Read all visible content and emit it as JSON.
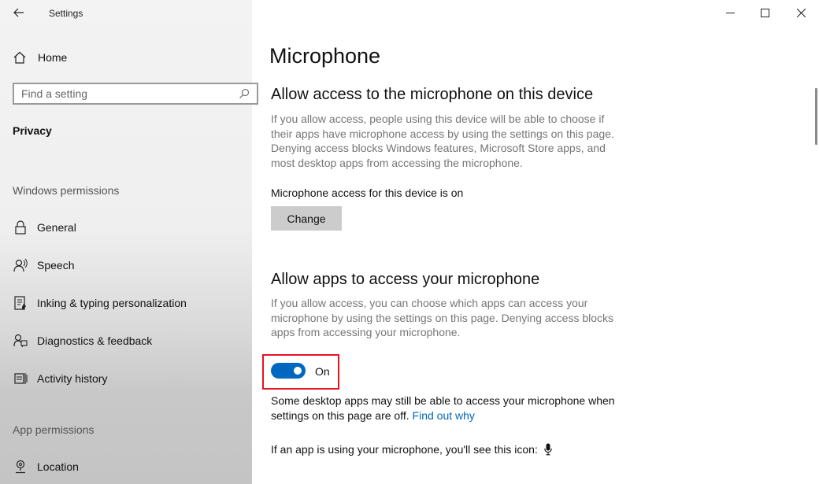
{
  "window": {
    "title": "Settings",
    "controls": {
      "minimize": "minimize-icon",
      "maximize": "maximize-icon",
      "close": "close-icon"
    }
  },
  "sidebar": {
    "home_label": "Home",
    "search_placeholder": "Find a setting",
    "current_section": "Privacy",
    "groups": [
      {
        "header": "Windows permissions",
        "items": [
          {
            "label": "General",
            "icon": "lock-icon"
          },
          {
            "label": "Speech",
            "icon": "speech-icon"
          },
          {
            "label": "Inking & typing personalization",
            "icon": "inking-icon"
          },
          {
            "label": "Diagnostics & feedback",
            "icon": "diagnostics-icon"
          },
          {
            "label": "Activity history",
            "icon": "activity-history-icon"
          }
        ]
      },
      {
        "header": "App permissions",
        "items": [
          {
            "label": "Location",
            "icon": "location-icon"
          }
        ]
      }
    ]
  },
  "main": {
    "page_title": "Microphone",
    "device_section": {
      "heading": "Allow access to the microphone on this device",
      "description": "If you allow access, people using this device will be able to choose if their apps have microphone access by using the settings on this page. Denying access blocks Windows features, Microsoft Store apps, and most desktop apps from accessing the microphone.",
      "status": "Microphone access for this device is on",
      "change_button": "Change"
    },
    "apps_section": {
      "heading": "Allow apps to access your microphone",
      "description": "If you allow access, you can choose which apps can access your microphone by using the settings on this page. Denying access blocks apps from accessing your microphone.",
      "toggle_state": "On",
      "toggle_on": true,
      "note_text": "Some desktop apps may still be able to access your microphone when settings on this page are off.",
      "note_link": "Find out why",
      "icon_note": "If an app is using your microphone, you'll see this icon:"
    }
  },
  "colors": {
    "accent": "#0067c0",
    "link": "#0067b8",
    "highlight_border": "#e81123"
  }
}
